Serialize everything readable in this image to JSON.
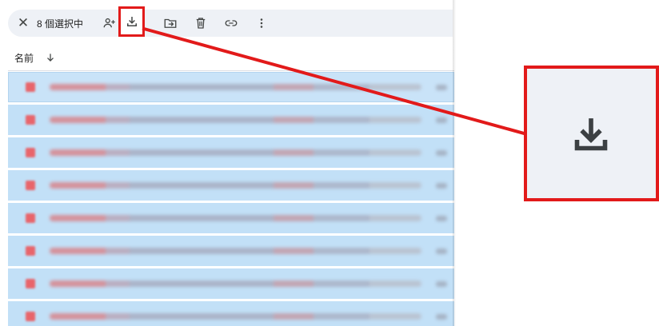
{
  "toolbar": {
    "close_glyph": "✕",
    "selection_count": "8 個選択中",
    "icons": [
      "close-icon",
      "share-person-add-icon",
      "download-icon",
      "move-to-folder-icon",
      "trash-icon",
      "link-icon",
      "more-vert-icon"
    ]
  },
  "list_header": {
    "name_label": "名前",
    "sort_icon": "arrow-down-icon"
  },
  "files": [
    {
      "type": "pdf"
    },
    {
      "type": "pdf"
    },
    {
      "type": "pdf"
    },
    {
      "type": "pdf"
    },
    {
      "type": "pdf"
    },
    {
      "type": "pdf"
    },
    {
      "type": "pdf"
    },
    {
      "type": "pdf"
    }
  ],
  "callout": {
    "target": "download-button",
    "zoom_icon": "download-icon",
    "highlight_color": "#e21a1a"
  },
  "colors": {
    "selection_bg": "#c2e0f7",
    "toolbar_bg": "#eef1f6",
    "icon_color": "#444746"
  }
}
